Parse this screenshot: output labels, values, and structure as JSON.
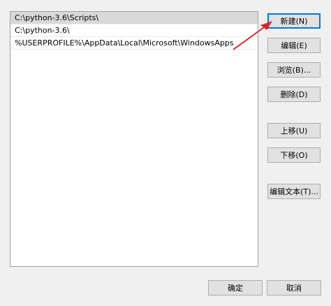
{
  "path_list": {
    "items": [
      "C:\\python-3.6\\Scripts\\",
      "C:\\python-3.6\\",
      "%USERPROFILE%\\AppData\\Local\\Microsoft\\WindowsApps"
    ]
  },
  "buttons": {
    "new": "新建(N)",
    "edit": "编辑(E)",
    "browse": "浏览(B)...",
    "delete": "删除(D)",
    "move_up": "上移(U)",
    "move_down": "下移(O)",
    "edit_text": "编辑文本(T)...",
    "ok": "确定",
    "cancel": "取消"
  },
  "colors": {
    "annotation_arrow": "#d9262b"
  }
}
